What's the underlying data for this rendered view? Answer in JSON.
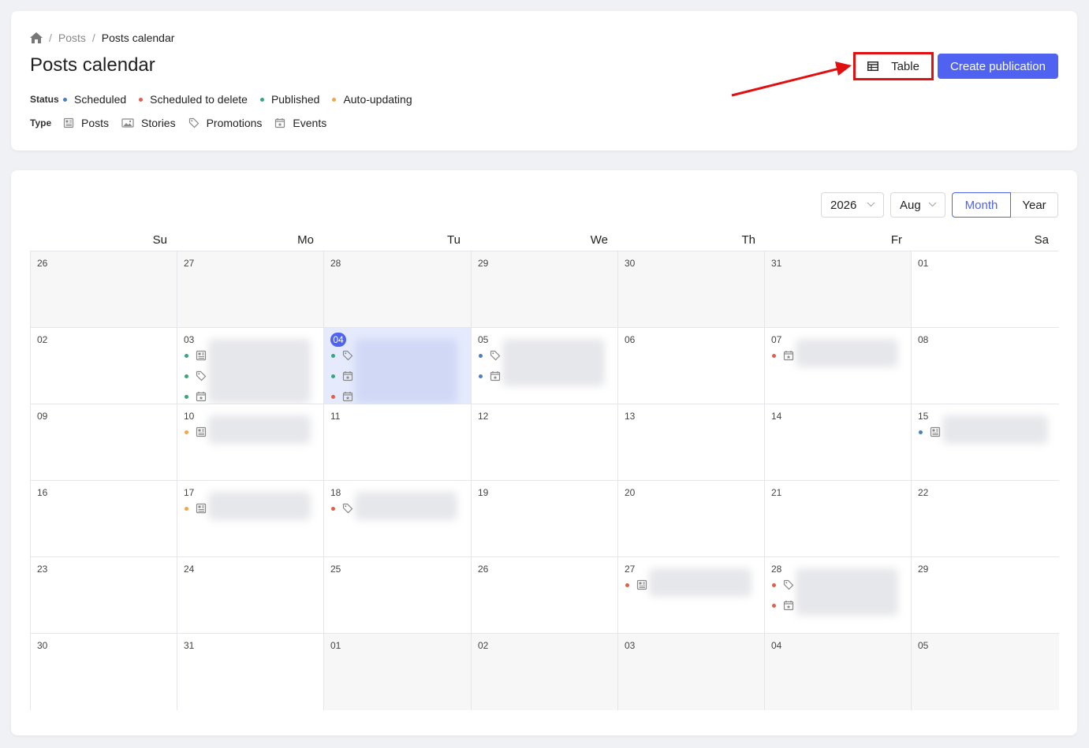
{
  "breadcrumb": {
    "home_icon": "home-icon",
    "posts": "Posts",
    "current": "Posts calendar",
    "separator": "/"
  },
  "page_title": "Posts calendar",
  "status_legend": {
    "label": "Status",
    "items": [
      {
        "label": "Scheduled",
        "color": "#4a7fc1"
      },
      {
        "label": "Scheduled to delete",
        "color": "#e0604d"
      },
      {
        "label": "Published",
        "color": "#3aa57a"
      },
      {
        "label": "Auto-updating",
        "color": "#f0a64a"
      }
    ]
  },
  "type_legend": {
    "label": "Type",
    "items": [
      {
        "label": "Posts",
        "icon": "newspaper-icon"
      },
      {
        "label": "Stories",
        "icon": "image-icon"
      },
      {
        "label": "Promotions",
        "icon": "tag-icon"
      },
      {
        "label": "Events",
        "icon": "calendar-star-icon"
      }
    ]
  },
  "actions": {
    "table_label": "Table",
    "create_label": "Create publication"
  },
  "calendar": {
    "year": "2026",
    "month": "Aug",
    "view_month": "Month",
    "view_year": "Year",
    "weekdays": [
      "Su",
      "Mo",
      "Tu",
      "We",
      "Th",
      "Fr",
      "Sa"
    ],
    "weeks": [
      [
        "26",
        "27",
        "28",
        "29",
        "30",
        "31",
        "01"
      ],
      [
        "02",
        "03",
        "04",
        "05",
        "06",
        "07",
        "08"
      ],
      [
        "09",
        "10",
        "11",
        "12",
        "13",
        "14",
        "15"
      ],
      [
        "16",
        "17",
        "18",
        "19",
        "20",
        "21",
        "22"
      ],
      [
        "23",
        "24",
        "25",
        "26",
        "27",
        "28",
        "29"
      ],
      [
        "30",
        "31",
        "01",
        "02",
        "03",
        "04",
        "05"
      ]
    ],
    "today": "04",
    "events": [
      {
        "week": 1,
        "day": 1,
        "items": [
          {
            "status": "published",
            "type": "newspaper-icon"
          },
          {
            "status": "published",
            "type": "tag-icon"
          },
          {
            "status": "published",
            "type": "calendar-star-icon"
          }
        ]
      },
      {
        "week": 1,
        "day": 2,
        "items": [
          {
            "status": "published",
            "type": "tag-icon"
          },
          {
            "status": "published",
            "type": "calendar-star-icon"
          },
          {
            "status": "delete",
            "type": "calendar-star-icon"
          }
        ]
      },
      {
        "week": 1,
        "day": 3,
        "items": [
          {
            "status": "scheduled",
            "type": "tag-icon"
          },
          {
            "status": "scheduled",
            "type": "calendar-star-icon"
          }
        ]
      },
      {
        "week": 1,
        "day": 5,
        "items": [
          {
            "status": "delete",
            "type": "calendar-star-icon"
          }
        ]
      },
      {
        "week": 2,
        "day": 1,
        "items": [
          {
            "status": "auto",
            "type": "newspaper-icon"
          }
        ]
      },
      {
        "week": 2,
        "day": 6,
        "items": [
          {
            "status": "scheduled",
            "type": "newspaper-icon"
          }
        ]
      },
      {
        "week": 3,
        "day": 1,
        "items": [
          {
            "status": "auto",
            "type": "newspaper-icon"
          }
        ]
      },
      {
        "week": 3,
        "day": 2,
        "items": [
          {
            "status": "delete",
            "type": "tag-icon"
          }
        ]
      },
      {
        "week": 4,
        "day": 4,
        "items": [
          {
            "status": "delete",
            "type": "newspaper-icon"
          }
        ]
      },
      {
        "week": 4,
        "day": 5,
        "items": [
          {
            "status": "delete",
            "type": "tag-icon"
          },
          {
            "status": "delete",
            "type": "calendar-star-icon"
          }
        ]
      }
    ]
  }
}
